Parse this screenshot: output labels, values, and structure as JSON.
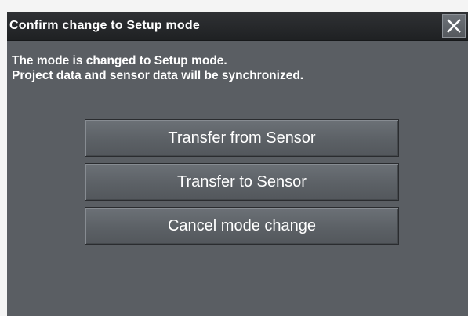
{
  "dialog": {
    "title": "Confirm change to Setup mode",
    "close_icon": "close-icon",
    "message_lines": [
      "The mode is changed to Setup mode.",
      "Project data and sensor data will be synchronized."
    ],
    "buttons": [
      {
        "label": "Transfer from Sensor"
      },
      {
        "label": "Transfer to Sensor"
      },
      {
        "label": "Cancel mode change"
      }
    ]
  },
  "colors": {
    "dialog_background": "#5a5e63",
    "titlebar_background": "#2a2c2f",
    "text": "#ffffff"
  }
}
